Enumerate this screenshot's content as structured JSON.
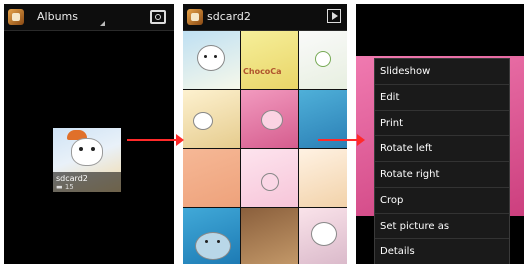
{
  "screen1": {
    "title": "Albums",
    "album": {
      "name": "sdcard2",
      "count": "15"
    }
  },
  "screen2": {
    "title": "sdcard2",
    "thumb_text": "ChocoCa"
  },
  "screen3": {
    "menu": [
      "Slideshow",
      "Edit",
      "Print",
      "Rotate left",
      "Rotate right",
      "Crop",
      "Set picture as",
      "Details"
    ]
  },
  "colors": {
    "arrow": "#ff2a2a",
    "menu_bg": "#1a1a1a"
  }
}
